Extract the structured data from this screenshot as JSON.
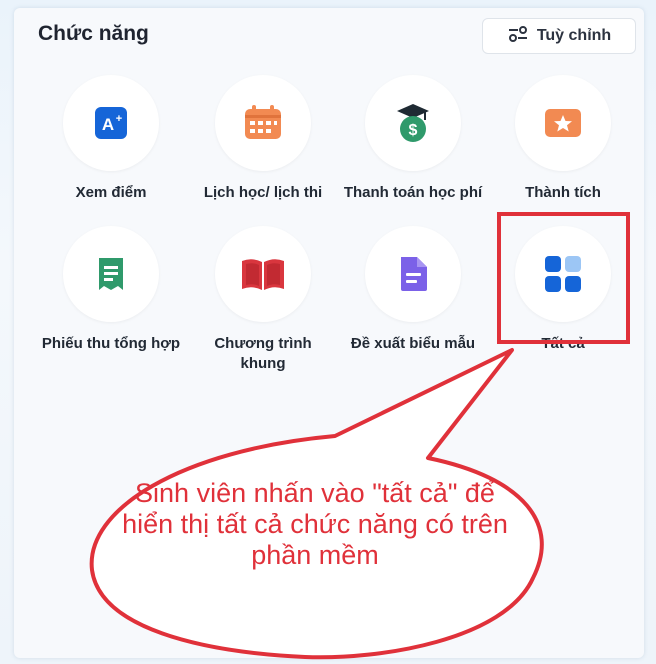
{
  "header": {
    "title": "Chức năng",
    "customize_label": "Tuỳ chỉnh"
  },
  "features": [
    {
      "label": "Xem điểm",
      "icon": "grade-icon"
    },
    {
      "label": "Lịch học/ lịch thi",
      "icon": "calendar-icon"
    },
    {
      "label": "Thanh toán học phí",
      "icon": "tuition-payment-icon"
    },
    {
      "label": "Thành tích",
      "icon": "achievement-icon"
    },
    {
      "label": "Phiếu thu tổng hợp",
      "icon": "receipt-icon"
    },
    {
      "label": "Chương trình khung",
      "icon": "curriculum-book-icon"
    },
    {
      "label": "Đề xuất biểu mẫu",
      "icon": "form-document-icon"
    },
    {
      "label": "Tất cả",
      "icon": "grid-all-icon"
    }
  ],
  "callout": {
    "text": "Sinh viên nhấn vào \"tất cả\" để hiển thị tất cả chức năng có trên phần mềm"
  },
  "colors": {
    "annotation_red": "#e0313a",
    "blue": "#1565d8",
    "orange": "#f28a52",
    "green": "#2f9a6b",
    "red_book": "#d9363e",
    "purple": "#7b61e8"
  }
}
